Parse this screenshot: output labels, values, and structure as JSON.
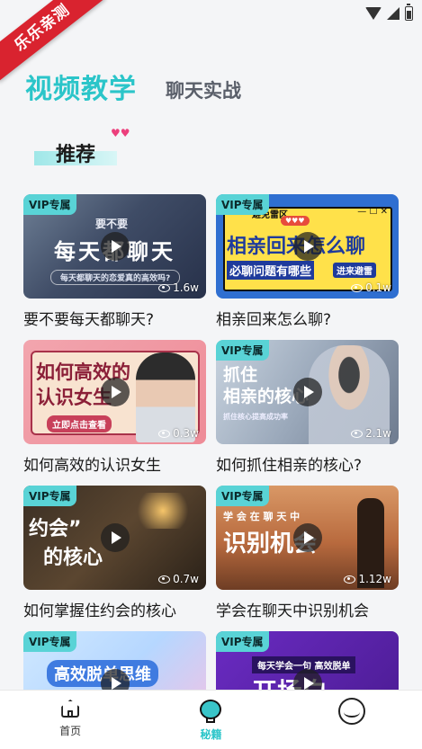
{
  "ribbon": {
    "label": "乐乐亲测"
  },
  "tabs": [
    {
      "label": "视频教学",
      "active": true
    },
    {
      "label": "聊天实战",
      "active": false
    }
  ],
  "section": {
    "title": "推荐",
    "decoration": "heart-icon"
  },
  "cards": [
    {
      "badge": "VIP专属",
      "views": "1.6w",
      "title": "要不要每天都聊天?",
      "overlay": [
        "要不要",
        "每天都聊天",
        "每天都聊天的恋爱真的高效吗?"
      ]
    },
    {
      "badge": "VIP专属",
      "views": "0.1w",
      "title": "相亲回来怎么聊?",
      "overlay": [
        "避免雷区",
        "相亲回来怎么聊",
        "必聊问题有哪些",
        "进来避雷"
      ]
    },
    {
      "badge": "",
      "views": "0.3w",
      "title": "如何高效的认识女生",
      "overlay": [
        "如何高效的",
        "认识女生",
        "立即点击查看"
      ]
    },
    {
      "badge": "VIP专属",
      "views": "2.1w",
      "title": "如何抓住相亲的核心?",
      "overlay": [
        "抓住",
        "相亲的核心",
        "抓住核心提高成功率"
      ]
    },
    {
      "badge": "VIP专属",
      "views": "0.7w",
      "title": "如何掌握住约会的核心",
      "overlay": [
        "约会”",
        "的核心"
      ]
    },
    {
      "badge": "VIP专属",
      "views": "1.12w",
      "title": "学会在聊天中识别机会",
      "overlay": [
        "学 会 在 聊 天 中",
        "识别机会"
      ]
    },
    {
      "badge": "VIP专属",
      "views": "",
      "title": "",
      "overlay": [
        "高效脱单思维"
      ]
    },
    {
      "badge": "VIP专属",
      "views": "",
      "title": "",
      "overlay": [
        "每天学会一句 高效脱单",
        "开场白"
      ]
    }
  ],
  "bottom_nav": [
    {
      "label": "首页",
      "icon": "home-icon",
      "active": false
    },
    {
      "label": "秘籍",
      "icon": "lightbulb-icon",
      "active": true
    },
    {
      "label": "",
      "icon": "profile-icon",
      "active": false
    }
  ],
  "colors": {
    "accent": "#2bc5c9",
    "vip_badge": "#59d3d6",
    "ribbon": "#d9232f"
  }
}
